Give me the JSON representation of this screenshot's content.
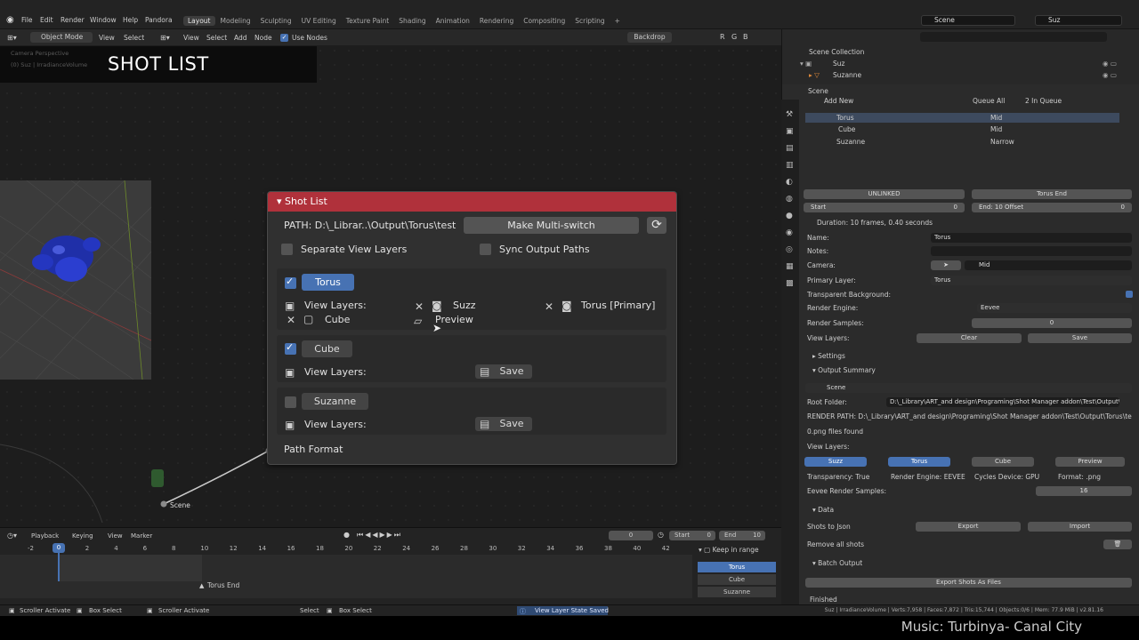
{
  "menu": {
    "items": [
      "File",
      "Edit",
      "Render",
      "Window",
      "Help",
      "Pandora"
    ],
    "workspaces": [
      "Layout",
      "Modeling",
      "Sculpting",
      "UV Editing",
      "Texture Paint",
      "Shading",
      "Animation",
      "Rendering",
      "Compositing",
      "Scripting"
    ],
    "active_workspace": "Layout",
    "scene_field": "Scene",
    "view_layer_field": "Suz"
  },
  "node_header": {
    "mode": "Object Mode",
    "items": [
      "View",
      "Select",
      "View",
      "Select",
      "Add",
      "Node"
    ],
    "use_nodes_label": "Use Nodes",
    "use_nodes": true,
    "backdrop_label": "Backdrop",
    "channels": [
      "R",
      "G",
      "B"
    ]
  },
  "viewport_overlay": {
    "line1": "Camera Perspective",
    "line2": "(0) Suz | IrradianceVolume"
  },
  "banner_title": "SHOT LIST",
  "scene_node_label": "Scene",
  "shot_panel": {
    "title": "Shot List",
    "path": "PATH: D:\\_Librar..\\Output\\Torus\\test",
    "make_multiswitch": "Make Multi-switch",
    "separate_view_layers": "Separate View Layers",
    "sync_output_paths": "Sync Output Paths",
    "shots": [
      {
        "name": "Torus",
        "checked": true,
        "selected": true,
        "view_layers_label": "View Layers:",
        "layers": [
          "Suzz",
          "Torus [Primary]",
          "Cube",
          "Preview"
        ]
      },
      {
        "name": "Cube",
        "checked": true,
        "selected": false,
        "view_layers_label": "View Layers:",
        "save": "Save"
      },
      {
        "name": "Suzanne",
        "checked": false,
        "selected": false,
        "view_layers_label": "View Layers:",
        "save": "Save"
      }
    ],
    "path_format": "Path Format"
  },
  "outliner": {
    "collection": "Scene Collection",
    "items": [
      "Suz",
      "Suzanne"
    ]
  },
  "props": {
    "scene_label": "Scene",
    "add_new": "Add New",
    "queue_all": "Queue All",
    "in_queue": "2 In Queue",
    "shot_rows": [
      {
        "name": "Torus",
        "camera": "Mid"
      },
      {
        "name": "Cube",
        "camera": "Mid"
      },
      {
        "name": "Suzanne",
        "camera": "Narrow"
      }
    ],
    "unlinked": "UNLINKED",
    "torus_end": "Torus End",
    "start_label": "Start",
    "start_value": "0",
    "end_label": "End: 10",
    "offset_label": "Offset",
    "offset_value": "0",
    "duration": "Duration: 10 frames,  0.40 seconds",
    "fields": [
      {
        "label": "Name:",
        "value": "Torus"
      },
      {
        "label": "Notes:",
        "value": ""
      },
      {
        "label": "Camera:",
        "value": "Mid"
      },
      {
        "label": "Primary Layer:",
        "value": "Torus"
      },
      {
        "label": "Transparent Background:",
        "value": ""
      },
      {
        "label": "Render Engine:",
        "value": "Eevee"
      },
      {
        "label": "Render Samples:",
        "value": "0"
      },
      {
        "label": "View Layers:",
        "value": ""
      }
    ],
    "clear": "Clear",
    "save": "Save",
    "settings": "Settings",
    "output_summary": "Output Summary",
    "summary_scene": "Scene",
    "root_folder_label": "Root Folder:",
    "root_folder": "D:\\_Library\\ART_and design\\Programing\\Shot Manager addon\\Test\\Output\\",
    "render_path": "RENDER PATH:  D:\\_Library\\ART_and design\\Programing\\Shot Manager addon\\Test\\Output\\Torus\\test\\Torus_",
    "files_found": "0.png files found",
    "view_layers_label": "View Layers:",
    "layer_pills": [
      "Suzz",
      "Torus",
      "Cube",
      "Preview"
    ],
    "transparency": "Transparency: True",
    "render_engine": "Render Engine: EEVEE",
    "cycles_device": "Cycles Device: GPU",
    "format": "Format: .png",
    "eevee_samples_label": "Eevee Render Samples:",
    "eevee_samples": "16",
    "data": "Data",
    "shots_to_json": "Shots to Json",
    "export": "Export",
    "import": "Import",
    "remove_all": "Remove all shots",
    "batch_output": "Batch Output",
    "export_shots": "Export Shots As Files",
    "finished": "Finished"
  },
  "timeline": {
    "menu": [
      "Playback",
      "Keying",
      "View",
      "Marker"
    ],
    "current_frame": "0",
    "start_label": "Start",
    "start": "0",
    "end_label": "End",
    "end": "10",
    "ticks": [
      "-2",
      "0",
      "2",
      "4",
      "6",
      "8",
      "10",
      "12",
      "14",
      "16",
      "18",
      "20",
      "22",
      "24",
      "26",
      "28",
      "30",
      "32",
      "34",
      "36",
      "38",
      "40",
      "42"
    ],
    "marker": "Torus End",
    "keep_in_range": "Keep in range",
    "shots": [
      "Torus",
      "Cube",
      "Suzanne"
    ]
  },
  "statusbar": {
    "items": [
      "Scroller Activate",
      "Box Select",
      "Scroller Activate",
      "Select",
      "Box Select"
    ],
    "message": "View Layer State Saved",
    "stats": "Suz | IrradianceVolume | Verts:7,958 | Faces:7,872 | Tris:15,744 | Objects:0/6 | Mem: 77.9 MiB | v2.81.16"
  },
  "music": "Music: Turbinya- Canal City",
  "colors": {
    "accent": "#4772b3",
    "panel_header": "#b0313b",
    "bg": "#1d1d1d"
  }
}
